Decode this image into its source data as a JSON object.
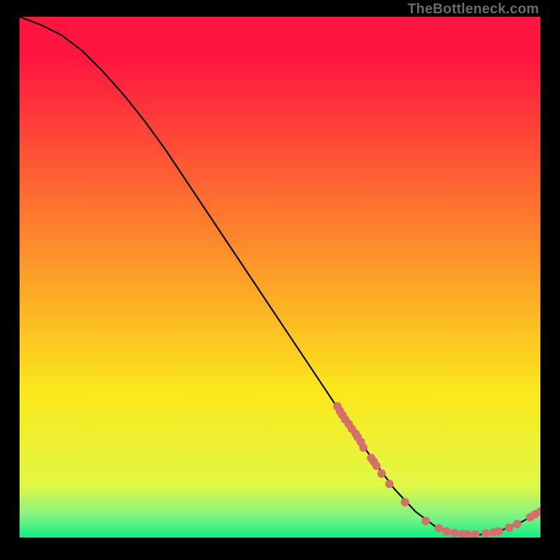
{
  "watermark": "TheBottleneck.com",
  "colors": {
    "gradient_top": "#fe1640",
    "gradient_mid1": "#fd8f2a",
    "gradient_mid2": "#fbe81b",
    "gradient_mid3": "#e0f846",
    "gradient_mid4": "#7ef385",
    "gradient_bottom": "#0eef84",
    "line": "#000000",
    "dot_fill": "#d66e6b",
    "dot_stroke": "#d66e6b",
    "background": "#000000"
  },
  "chart_data": {
    "type": "line",
    "title": "",
    "xlabel": "",
    "ylabel": "",
    "xlim": [
      0,
      100
    ],
    "ylim": [
      0,
      100
    ],
    "series": [
      {
        "name": "curve",
        "x": [
          0,
          4,
          8,
          12,
          16,
          20,
          24,
          28,
          32,
          36,
          40,
          44,
          48,
          52,
          56,
          60,
          64,
          68,
          72,
          76,
          80,
          84,
          88,
          92,
          96,
          100
        ],
        "y": [
          100,
          98.5,
          96.5,
          93.5,
          89.5,
          85.0,
          80.0,
          74.5,
          68.5,
          62.5,
          56.5,
          50.5,
          44.5,
          38.5,
          32.5,
          26.5,
          20.5,
          14.7,
          9.3,
          5.0,
          2.0,
          0.8,
          0.5,
          1.2,
          2.8,
          5.0
        ]
      }
    ],
    "points": [
      {
        "x": 61.0,
        "y": 25.2
      },
      {
        "x": 61.5,
        "y": 24.3
      },
      {
        "x": 62.0,
        "y": 23.5
      },
      {
        "x": 62.5,
        "y": 22.7
      },
      {
        "x": 63.2,
        "y": 21.8
      },
      {
        "x": 63.8,
        "y": 20.9
      },
      {
        "x": 64.5,
        "y": 20.0
      },
      {
        "x": 64.9,
        "y": 19.3
      },
      {
        "x": 65.5,
        "y": 18.4
      },
      {
        "x": 66.0,
        "y": 17.3
      },
      {
        "x": 67.5,
        "y": 15.3
      },
      {
        "x": 68.0,
        "y": 14.6
      },
      {
        "x": 68.5,
        "y": 13.8
      },
      {
        "x": 69.5,
        "y": 12.3
      },
      {
        "x": 71.0,
        "y": 10.3
      },
      {
        "x": 74.0,
        "y": 6.8
      },
      {
        "x": 78.0,
        "y": 3.2
      },
      {
        "x": 80.5,
        "y": 1.8
      },
      {
        "x": 82.0,
        "y": 1.2
      },
      {
        "x": 83.5,
        "y": 0.9
      },
      {
        "x": 85.0,
        "y": 0.7
      },
      {
        "x": 86.0,
        "y": 0.6
      },
      {
        "x": 87.5,
        "y": 0.6
      },
      {
        "x": 89.5,
        "y": 0.8
      },
      {
        "x": 91.0,
        "y": 1.0
      },
      {
        "x": 92.0,
        "y": 1.2
      },
      {
        "x": 94.0,
        "y": 1.9
      },
      {
        "x": 95.5,
        "y": 2.6
      },
      {
        "x": 98.0,
        "y": 3.9
      },
      {
        "x": 99.0,
        "y": 4.5
      },
      {
        "x": 100.0,
        "y": 5.0
      }
    ]
  }
}
